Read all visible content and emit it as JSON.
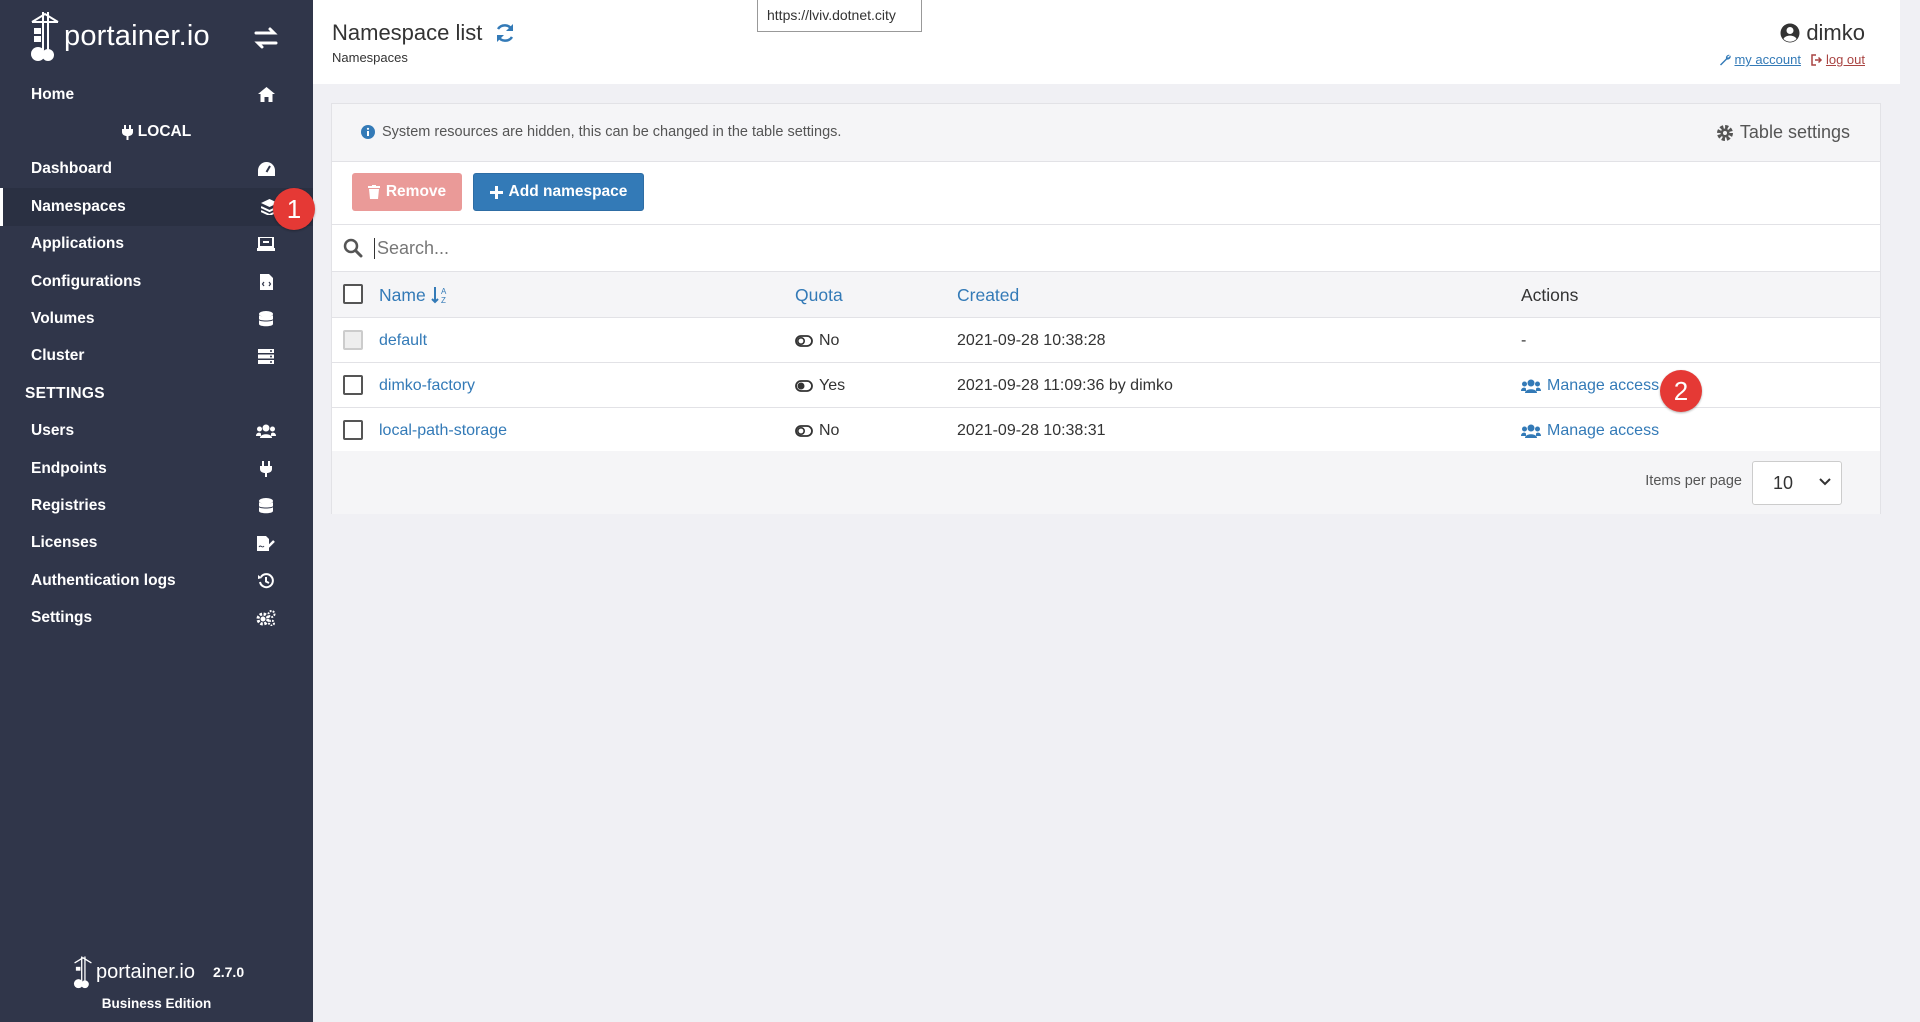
{
  "app": {
    "brand": "portainer.io",
    "version": "2.7.0",
    "edition": "Business Edition"
  },
  "tooltip": {
    "text": "https://lviv.dotnet.city"
  },
  "sidebar": {
    "home": "Home",
    "endpoint_heading": "LOCAL",
    "items": [
      {
        "label": "Dashboard",
        "icon": "dashboard-icon"
      },
      {
        "label": "Namespaces",
        "icon": "layers-icon",
        "active": true
      },
      {
        "label": "Applications",
        "icon": "laptop-icon"
      },
      {
        "label": "Configurations",
        "icon": "file-code-icon"
      },
      {
        "label": "Volumes",
        "icon": "database-icon"
      },
      {
        "label": "Cluster",
        "icon": "server-icon"
      }
    ],
    "settings_heading": "SETTINGS",
    "settings_items": [
      {
        "label": "Users",
        "icon": "users-icon"
      },
      {
        "label": "Endpoints",
        "icon": "plug-icon"
      },
      {
        "label": "Registries",
        "icon": "database-icon"
      },
      {
        "label": "Licenses",
        "icon": "file-signature-icon"
      },
      {
        "label": "Authentication logs",
        "icon": "history-icon"
      },
      {
        "label": "Settings",
        "icon": "cogs-icon"
      }
    ]
  },
  "badges": {
    "one": "1",
    "two": "2"
  },
  "header": {
    "title": "Namespace list",
    "breadcrumb": "Namespaces",
    "username": "dimko",
    "my_account": "my account",
    "log_out": "log out"
  },
  "panel": {
    "info": "System resources are hidden, this can be changed in the table settings.",
    "table_settings": "Table settings",
    "remove": "Remove",
    "add_namespace": "Add namespace",
    "search_placeholder": "Search...",
    "columns": {
      "name": "Name",
      "quota": "Quota",
      "created": "Created",
      "actions": "Actions"
    },
    "rows": [
      {
        "name": "default",
        "quota": "No",
        "quota_on": false,
        "created": "2021-09-28 10:38:28",
        "action": "-",
        "system": true
      },
      {
        "name": "dimko-factory",
        "quota": "Yes",
        "quota_on": true,
        "created": "2021-09-28 11:09:36 by dimko",
        "action": "Manage access",
        "system": false
      },
      {
        "name": "local-path-storage",
        "quota": "No",
        "quota_on": false,
        "created": "2021-09-28 10:38:31",
        "action": "Manage access",
        "system": false
      }
    ],
    "items_per_page_label": "Items per page",
    "items_per_page_value": "10"
  },
  "colors": {
    "sidebar": "#30364a",
    "primary": "#337ab7",
    "danger_light": "#ea9a98",
    "badge": "#e53935"
  }
}
